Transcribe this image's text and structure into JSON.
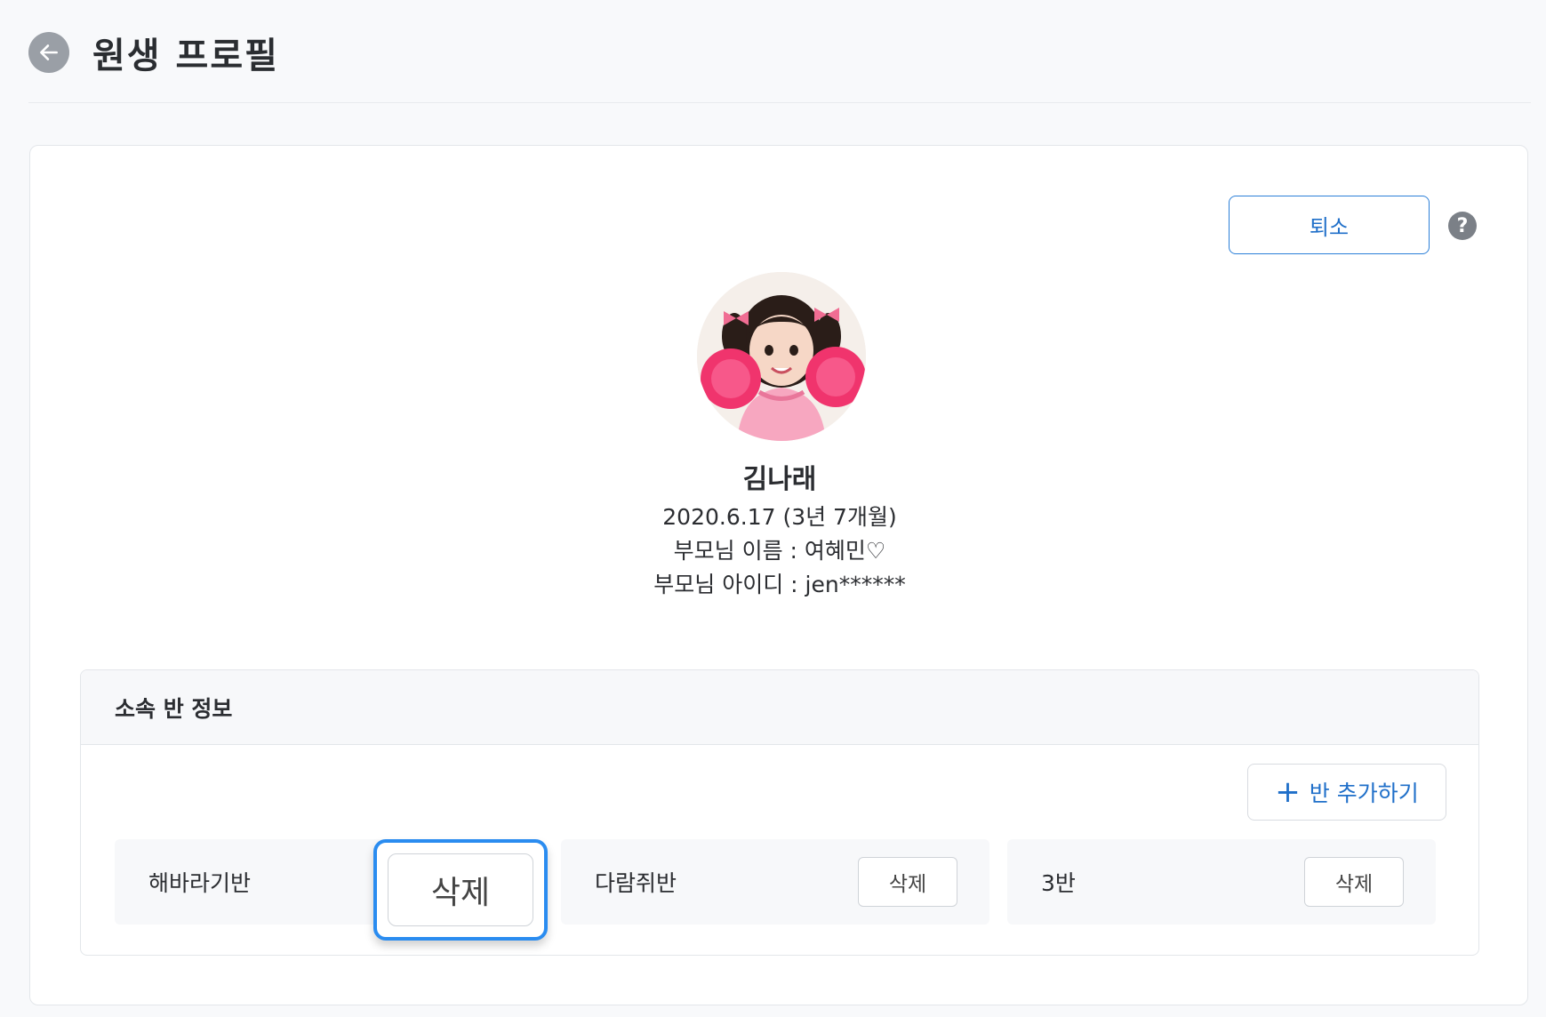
{
  "header": {
    "title": "원생 프로필"
  },
  "actions": {
    "withdraw_label": "퇴소",
    "help_label": "?"
  },
  "profile": {
    "name": "김나래",
    "birth": "2020.6.17 (3년 7개월)",
    "parent_name": "부모님 이름 : 여혜민♡",
    "parent_id": "부모님 아이디 : jen******"
  },
  "class_info": {
    "title": "소속 반 정보",
    "add_label": "반 추가하기",
    "classes": [
      {
        "name": "해바라기반",
        "delete_label": "삭제"
      },
      {
        "name": "다람쥐반",
        "delete_label": "삭제"
      },
      {
        "name": "3반",
        "delete_label": "삭제"
      }
    ]
  },
  "colors": {
    "accent": "#1f6fc9",
    "focus_ring": "#2a8cf0",
    "back_button": "#9a9fa6"
  },
  "icons": [
    "back-arrow-icon",
    "help-icon",
    "plus-icon"
  ]
}
